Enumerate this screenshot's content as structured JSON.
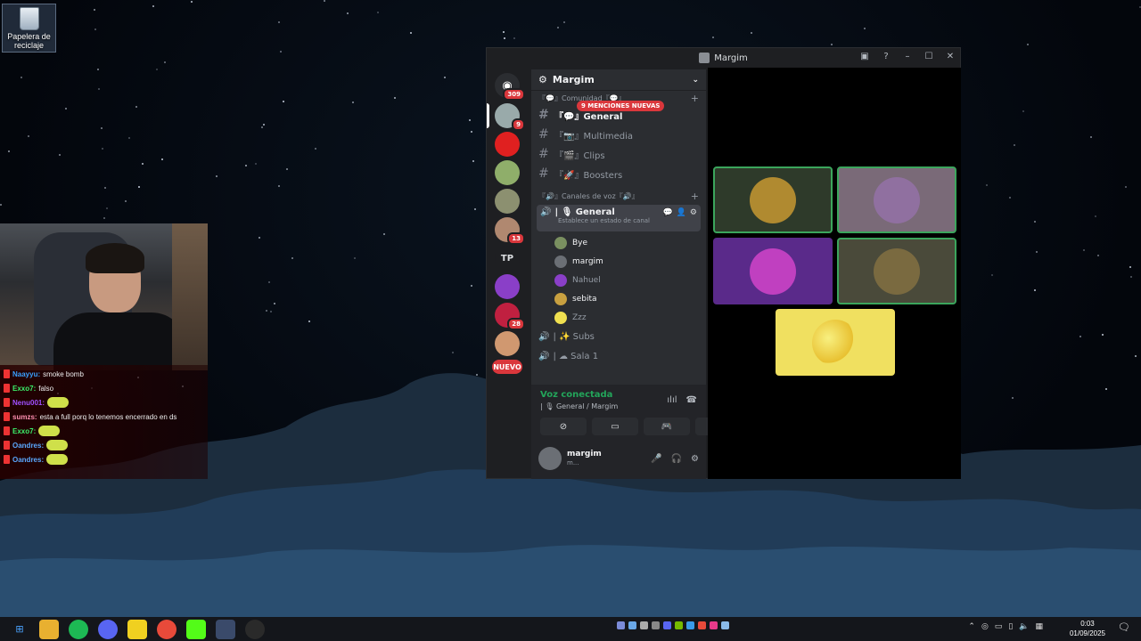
{
  "desktop": {
    "recycle_bin_label": "Papelera de reciclaje"
  },
  "stream_chat": [
    {
      "user": "Naayyu:",
      "user_color": "#3aa0ff",
      "message": "smoke bomb",
      "emote": false
    },
    {
      "user": "Exxo7:",
      "user_color": "#3cf06a",
      "message": "falso",
      "emote": false
    },
    {
      "user": "Nenu001:",
      "user_color": "#a050ff",
      "message": "",
      "emote": true
    },
    {
      "user": "sumzs:",
      "user_color": "#ff8fb0",
      "message": "esta a full porq lo tenemos encerrado en ds",
      "emote": false
    },
    {
      "user": "Exxo7:",
      "user_color": "#3cf06a",
      "message": "",
      "emote": true
    },
    {
      "user": "Oandres:",
      "user_color": "#5aa8ff",
      "message": "",
      "emote": true
    },
    {
      "user": "Oandres:",
      "user_color": "#5aa8ff",
      "message": "",
      "emote": true
    }
  ],
  "discord": {
    "window_title": "Margim",
    "home_badge": "309",
    "guilds": [
      {
        "color": "#9aa",
        "badge": "9"
      },
      {
        "color": "#e02020",
        "badge": ""
      },
      {
        "color": "#8fae6a",
        "badge": ""
      },
      {
        "color": "#8c9070",
        "badge": ""
      },
      {
        "color": "#b08870",
        "badge": "13"
      },
      {
        "color": "#1e1f22",
        "badge": "",
        "text": "TP"
      },
      {
        "color": "#8a3fc8",
        "badge": ""
      },
      {
        "color": "#c02040",
        "badge": "28"
      },
      {
        "color": "#d09870",
        "badge": ""
      }
    ],
    "new_label": "NUEVO",
    "server_name": "Margim",
    "mention_pill": "9 MENCIONES NUEVAS",
    "category_text": "『💬』Comunidad『💬』",
    "text_channels": [
      {
        "name": "『💬』General",
        "active": true
      },
      {
        "name": "『📷』Multimedia",
        "active": false
      },
      {
        "name": "『🎬』Clips",
        "active": false
      },
      {
        "name": "『🚀』Boosters",
        "active": false
      }
    ],
    "voice_category": "『🔊』Canales de voz『🔊』",
    "voice_channel": {
      "name": "| 🎙 General",
      "status": "Establece un estado de canal"
    },
    "voice_users": [
      {
        "name": "Bye",
        "color": "#7a9060",
        "dim": false
      },
      {
        "name": "margim",
        "color": "#6b6f75",
        "dim": false
      },
      {
        "name": "Nahuel",
        "color": "#8a3fc8",
        "dim": true
      },
      {
        "name": "sebita",
        "color": "#c8a040",
        "dim": false
      },
      {
        "name": "Zzz",
        "color": "#f0e050",
        "dim": true
      }
    ],
    "other_voice_channels": [
      {
        "name": "| ✨ Subs"
      },
      {
        "name": "| ☁ Sala 1"
      }
    ],
    "voice_panel": {
      "status": "Voz conectada",
      "location": "| 🎙 General / Margim"
    },
    "user_panel": {
      "name": "margim",
      "sub": "m..."
    },
    "tiles": [
      {
        "bg": "#2e3a2a",
        "avatar": "#b08a30",
        "speaking": true
      },
      {
        "bg": "#7a6a78",
        "avatar": "#9070a0",
        "speaking": true
      },
      {
        "bg": "#5a2a8a",
        "avatar": "#c040c0",
        "speaking": false
      },
      {
        "bg": "#4a4a3a",
        "avatar": "#7a6a40",
        "speaking": true
      },
      {
        "bg": "#f0e060",
        "avatar": "#f0e060",
        "speaking": false
      }
    ]
  },
  "taskbar": {
    "time": "0:03",
    "date": "01/09/2025"
  }
}
